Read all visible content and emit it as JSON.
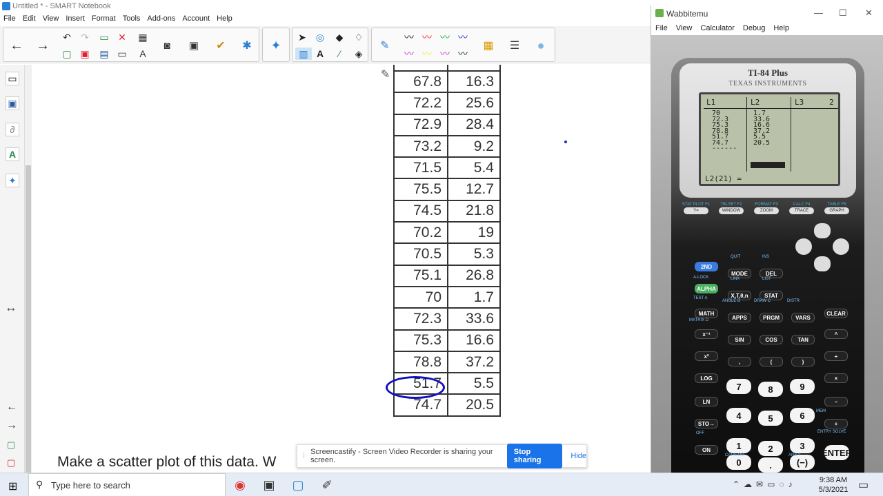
{
  "notebook": {
    "title": "Untitled * - SMART Notebook",
    "menu": [
      "File",
      "Edit",
      "View",
      "Insert",
      "Format",
      "Tools",
      "Add-ons",
      "Account",
      "Help"
    ],
    "table": {
      "rows": [
        [
          "67.8",
          "16.3"
        ],
        [
          "72.2",
          "25.6"
        ],
        [
          "72.9",
          "28.4"
        ],
        [
          "73.2",
          "9.2"
        ],
        [
          "71.5",
          "5.4"
        ],
        [
          "75.5",
          "12.7"
        ],
        [
          "74.5",
          "21.8"
        ],
        [
          "70.2",
          "19"
        ],
        [
          "70.5",
          "5.3"
        ],
        [
          "75.1",
          "26.8"
        ],
        [
          "70",
          "1.7"
        ],
        [
          "72.3",
          "33.6"
        ],
        [
          "75.3",
          "16.6"
        ],
        [
          "78.8",
          "37.2"
        ],
        [
          "51.7",
          "5.5"
        ],
        [
          "74.7",
          "20.5"
        ]
      ],
      "circled_value": "51.7"
    },
    "question_visible": "Make a scatter plot of this data. W"
  },
  "share_bar": {
    "message": "Screencastify - Screen Video Recorder is sharing your screen.",
    "stop_label": "Stop sharing",
    "hide_label": "Hide"
  },
  "wabbitemu": {
    "title": "Wabbitemu",
    "menu": [
      "File",
      "View",
      "Calculator",
      "Debug",
      "Help"
    ],
    "model": "TI-84 Plus",
    "brand": "TEXAS INSTRUMENTS",
    "screen": {
      "headers": [
        "L1",
        "L2",
        "L3",
        "2"
      ],
      "l1": [
        "70",
        "72.3",
        "75.3",
        "78.8",
        "51.7",
        "74.7",
        "------"
      ],
      "l2": [
        "1.7",
        "33.6",
        "16.6",
        "37.2",
        "5.5",
        "20.5"
      ],
      "edit_line": "L2(21) ="
    },
    "fkeys": [
      {
        "top": "STAT PLOT F1",
        "label": "Y="
      },
      {
        "top": "TBLSET F2",
        "label": "WINDOW"
      },
      {
        "top": "FORMAT F3",
        "label": "ZOOM"
      },
      {
        "top": "CALC F4",
        "label": "TRACE"
      },
      {
        "top": "TABLE F5",
        "label": "GRAPH"
      }
    ],
    "keys": {
      "second": "2ND",
      "mode": "MODE",
      "del": "DEL",
      "alpha": "ALPHA",
      "xt": "X,T,θ,n",
      "stat": "STAT",
      "math": "MATH",
      "apps": "APPS",
      "prgm": "PRGM",
      "vars": "VARS",
      "clear": "CLEAR",
      "inv": "x⁻¹",
      "sin": "SIN",
      "cos": "COS",
      "tan": "TAN",
      "pow": "^",
      "sq": "x²",
      "comma": ",",
      "lp": "(",
      "rp": ")",
      "div": "÷",
      "log": "LOG",
      "k7": "7",
      "k8": "8",
      "k9": "9",
      "mul": "×",
      "ln": "LN",
      "k4": "4",
      "k5": "5",
      "k6": "6",
      "sub": "−",
      "sto": "STO→",
      "k1": "1",
      "k2": "2",
      "k3": "3",
      "add": "+",
      "on": "ON",
      "k0": "0",
      "dot": ".",
      "neg": "(−)",
      "enter": "ENTER"
    },
    "labels": {
      "quit": "QUIT",
      "ins": "INS",
      "alock": "A-LOCK",
      "link": "LINK",
      "list": "LIST",
      "test": "TEST A",
      "angle": "ANGLE B",
      "draw": "DRAW C",
      "distr": "DISTR",
      "matrix": "MATRIX D",
      "off": "OFF",
      "catalog": "CATALOG",
      "ans": "ANS ?",
      "entry": "ENTRY SOLVE",
      "mem": "MEM"
    }
  },
  "taskbar": {
    "search_placeholder": "Type here to search",
    "time": "9:38 AM",
    "date": "5/3/2021"
  }
}
